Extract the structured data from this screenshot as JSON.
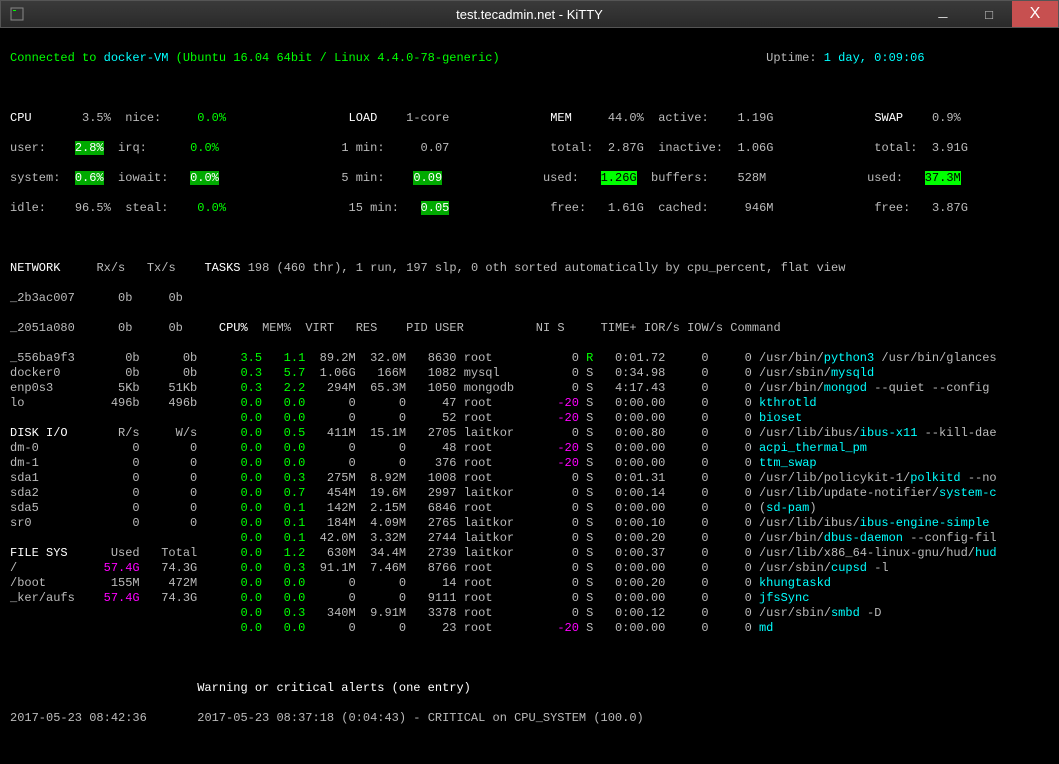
{
  "window": {
    "title": "test.tecadmin.net - KiTTY",
    "min": "_",
    "max": "□",
    "close": "X"
  },
  "header": {
    "connected": "Connected to ",
    "host": "docker-VM",
    "os": " (Ubuntu 16.04 64bit / Linux 4.4.0-78-generic)",
    "uptime_label": "Uptime: ",
    "uptime_value": "1 day, 0:09:06"
  },
  "cpu": {
    "title": "CPU",
    "pct": "3.5%",
    "user_label": "user:",
    "user_val": "2.8%",
    "system_label": "system:",
    "system_val": "0.6%",
    "idle_label": "idle:",
    "idle_val": "96.5%",
    "nice_label": "nice:",
    "nice_val": "0.0%",
    "irq_label": "irq:",
    "irq_val": "0.0%",
    "iowait_label": "iowait:",
    "iowait_val": "0.0%",
    "steal_label": "steal:",
    "steal_val": "0.0%"
  },
  "load": {
    "title": "LOAD",
    "cores": "1-core",
    "m1_label": "1 min:",
    "m1_val": "0.07",
    "m5_label": "5 min:",
    "m5_val": "0.09",
    "m15_label": "15 min:",
    "m15_val": "0.05"
  },
  "mem": {
    "title": "MEM",
    "pct": "44.0%",
    "total_label": "total:",
    "total_val": "2.87G",
    "used_label": "used:",
    "used_val": "1.26G",
    "free_label": "free:",
    "free_val": "1.61G",
    "active_label": "active:",
    "active_val": "1.19G",
    "inactive_label": "inactive:",
    "inactive_val": "1.06G",
    "buffers_label": "buffers:",
    "buffers_val": "528M",
    "cached_label": "cached:",
    "cached_val": "946M"
  },
  "swap": {
    "title": "SWAP",
    "pct": "0.9%",
    "total_label": "total:",
    "total_val": "3.91G",
    "used_label": "used:",
    "used_val": "37.3M",
    "free_label": "free:",
    "free_val": "3.87G"
  },
  "network": {
    "title": "NETWORK",
    "rx_hdr": "Rx/s",
    "tx_hdr": "Tx/s",
    "ifaces": [
      {
        "name": "_2b3ac007",
        "rx": "0b",
        "tx": "0b"
      },
      {
        "name": "_2051a080",
        "rx": "0b",
        "tx": "0b"
      },
      {
        "name": "_556ba9f3",
        "rx": "0b",
        "tx": "0b"
      },
      {
        "name": "docker0",
        "rx": "0b",
        "tx": "0b"
      },
      {
        "name": "enp0s3",
        "rx": "5Kb",
        "tx": "51Kb"
      },
      {
        "name": "lo",
        "rx": "496b",
        "tx": "496b"
      }
    ]
  },
  "disk": {
    "title": "DISK I/O",
    "r_hdr": "R/s",
    "w_hdr": "W/s",
    "items": [
      {
        "name": "dm-0",
        "r": "0",
        "w": "0"
      },
      {
        "name": "dm-1",
        "r": "0",
        "w": "0"
      },
      {
        "name": "sda1",
        "r": "0",
        "w": "0"
      },
      {
        "name": "sda2",
        "r": "0",
        "w": "0"
      },
      {
        "name": "sda5",
        "r": "0",
        "w": "0"
      },
      {
        "name": "sr0",
        "r": "0",
        "w": "0"
      }
    ]
  },
  "fs": {
    "title": "FILE SYS",
    "used_hdr": "Used",
    "total_hdr": "Total",
    "items": [
      {
        "name": "/",
        "used": "57.4G",
        "total": "74.3G",
        "hl": true
      },
      {
        "name": "/boot",
        "used": "155M",
        "total": "472M",
        "hl": false
      },
      {
        "name": "_ker/aufs",
        "used": "57.4G",
        "total": "74.3G",
        "hl": true
      }
    ]
  },
  "tasks": {
    "title": "TASKS",
    "summary": " 198 (460 thr), 1 run, 197 slp, 0 oth sorted automatically by cpu_percent, flat view",
    "hdr": {
      "cpu": "CPU%",
      "mem": "MEM%",
      "virt": "VIRT",
      "res": "RES",
      "pid": "PID",
      "user": "USER",
      "ni": "NI",
      "s": "S",
      "time": "TIME+",
      "ior": "IOR/s",
      "iow": "IOW/s",
      "cmd": "Command"
    },
    "procs": [
      {
        "cpu": "3.5",
        "mem": "1.1",
        "virt": "89.2M",
        "res": "32.0M",
        "pid": "8630",
        "user": "root",
        "ni": "0",
        "s": "R",
        "time": "0:01.72",
        "ior": "0",
        "iow": "0",
        "cmd_pre": "/usr/bin/",
        "cmd_exe": "python3",
        "cmd_post": " /usr/bin/glances"
      },
      {
        "cpu": "0.3",
        "mem": "5.7",
        "virt": "1.06G",
        "res": "166M",
        "pid": "1082",
        "user": "mysql",
        "ni": "0",
        "s": "S",
        "time": "0:34.98",
        "ior": "0",
        "iow": "0",
        "cmd_pre": "/usr/sbin/",
        "cmd_exe": "mysqld",
        "cmd_post": ""
      },
      {
        "cpu": "0.3",
        "mem": "2.2",
        "virt": "294M",
        "res": "65.3M",
        "pid": "1050",
        "user": "mongodb",
        "ni": "0",
        "s": "S",
        "time": "4:17.43",
        "ior": "0",
        "iow": "0",
        "cmd_pre": "/usr/bin/",
        "cmd_exe": "mongod",
        "cmd_post": " --quiet --config"
      },
      {
        "cpu": "0.0",
        "mem": "0.0",
        "virt": "0",
        "res": "0",
        "pid": "47",
        "user": "root",
        "ni": "-20",
        "s": "S",
        "time": "0:00.00",
        "ior": "0",
        "iow": "0",
        "cmd_pre": "",
        "cmd_exe": "kthrotld",
        "cmd_post": ""
      },
      {
        "cpu": "0.0",
        "mem": "0.0",
        "virt": "0",
        "res": "0",
        "pid": "52",
        "user": "root",
        "ni": "-20",
        "s": "S",
        "time": "0:00.00",
        "ior": "0",
        "iow": "0",
        "cmd_pre": "",
        "cmd_exe": "bioset",
        "cmd_post": ""
      },
      {
        "cpu": "0.0",
        "mem": "0.5",
        "virt": "411M",
        "res": "15.1M",
        "pid": "2705",
        "user": "laitkor",
        "ni": "0",
        "s": "S",
        "time": "0:00.80",
        "ior": "0",
        "iow": "0",
        "cmd_pre": "/usr/lib/ibus/",
        "cmd_exe": "ibus-x11",
        "cmd_post": " --kill-dae"
      },
      {
        "cpu": "0.0",
        "mem": "0.0",
        "virt": "0",
        "res": "0",
        "pid": "48",
        "user": "root",
        "ni": "-20",
        "s": "S",
        "time": "0:00.00",
        "ior": "0",
        "iow": "0",
        "cmd_pre": "",
        "cmd_exe": "acpi_thermal_pm",
        "cmd_post": ""
      },
      {
        "cpu": "0.0",
        "mem": "0.0",
        "virt": "0",
        "res": "0",
        "pid": "376",
        "user": "root",
        "ni": "-20",
        "s": "S",
        "time": "0:00.00",
        "ior": "0",
        "iow": "0",
        "cmd_pre": "",
        "cmd_exe": "ttm_swap",
        "cmd_post": ""
      },
      {
        "cpu": "0.0",
        "mem": "0.3",
        "virt": "275M",
        "res": "8.92M",
        "pid": "1008",
        "user": "root",
        "ni": "0",
        "s": "S",
        "time": "0:01.31",
        "ior": "0",
        "iow": "0",
        "cmd_pre": "/usr/lib/policykit-1/",
        "cmd_exe": "polkitd",
        "cmd_post": " --no"
      },
      {
        "cpu": "0.0",
        "mem": "0.7",
        "virt": "454M",
        "res": "19.6M",
        "pid": "2997",
        "user": "laitkor",
        "ni": "0",
        "s": "S",
        "time": "0:00.14",
        "ior": "0",
        "iow": "0",
        "cmd_pre": "/usr/lib/update-notifier/",
        "cmd_exe": "system-c",
        "cmd_post": ""
      },
      {
        "cpu": "0.0",
        "mem": "0.1",
        "virt": "142M",
        "res": "2.15M",
        "pid": "6846",
        "user": "root",
        "ni": "0",
        "s": "S",
        "time": "0:00.00",
        "ior": "0",
        "iow": "0",
        "cmd_pre": "(",
        "cmd_exe": "sd-pam",
        "cmd_post": ")"
      },
      {
        "cpu": "0.0",
        "mem": "0.1",
        "virt": "184M",
        "res": "4.09M",
        "pid": "2765",
        "user": "laitkor",
        "ni": "0",
        "s": "S",
        "time": "0:00.10",
        "ior": "0",
        "iow": "0",
        "cmd_pre": "/usr/lib/ibus/",
        "cmd_exe": "ibus-engine-simple",
        "cmd_post": ""
      },
      {
        "cpu": "0.0",
        "mem": "0.1",
        "virt": "42.0M",
        "res": "3.32M",
        "pid": "2744",
        "user": "laitkor",
        "ni": "0",
        "s": "S",
        "time": "0:00.20",
        "ior": "0",
        "iow": "0",
        "cmd_pre": "/usr/bin/",
        "cmd_exe": "dbus-daemon",
        "cmd_post": " --config-fil"
      },
      {
        "cpu": "0.0",
        "mem": "1.2",
        "virt": "630M",
        "res": "34.4M",
        "pid": "2739",
        "user": "laitkor",
        "ni": "0",
        "s": "S",
        "time": "0:00.37",
        "ior": "0",
        "iow": "0",
        "cmd_pre": "/usr/lib/x86_64-linux-gnu/hud/",
        "cmd_exe": "hud",
        "cmd_post": ""
      },
      {
        "cpu": "0.0",
        "mem": "0.3",
        "virt": "91.1M",
        "res": "7.46M",
        "pid": "8766",
        "user": "root",
        "ni": "0",
        "s": "S",
        "time": "0:00.00",
        "ior": "0",
        "iow": "0",
        "cmd_pre": "/usr/sbin/",
        "cmd_exe": "cupsd",
        "cmd_post": " -l"
      },
      {
        "cpu": "0.0",
        "mem": "0.0",
        "virt": "0",
        "res": "0",
        "pid": "14",
        "user": "root",
        "ni": "0",
        "s": "S",
        "time": "0:00.20",
        "ior": "0",
        "iow": "0",
        "cmd_pre": "",
        "cmd_exe": "khungtaskd",
        "cmd_post": ""
      },
      {
        "cpu": "0.0",
        "mem": "0.0",
        "virt": "0",
        "res": "0",
        "pid": "9111",
        "user": "root",
        "ni": "0",
        "s": "S",
        "time": "0:00.00",
        "ior": "0",
        "iow": "0",
        "cmd_pre": "",
        "cmd_exe": "jfsSync",
        "cmd_post": ""
      },
      {
        "cpu": "0.0",
        "mem": "0.3",
        "virt": "340M",
        "res": "9.91M",
        "pid": "3378",
        "user": "root",
        "ni": "0",
        "s": "S",
        "time": "0:00.12",
        "ior": "0",
        "iow": "0",
        "cmd_pre": "/usr/sbin/",
        "cmd_exe": "smbd",
        "cmd_post": " -D"
      },
      {
        "cpu": "0.0",
        "mem": "0.0",
        "virt": "0",
        "res": "0",
        "pid": "23",
        "user": "root",
        "ni": "-20",
        "s": "S",
        "time": "0:00.00",
        "ior": "0",
        "iow": "0",
        "cmd_pre": "",
        "cmd_exe": "md",
        "cmd_post": ""
      }
    ]
  },
  "footer": {
    "alerts_title": "Warning or critical alerts (one entry)",
    "now": "2017-05-23 08:42:36",
    "alert": "2017-05-23 08:37:18 (0:04:43) - CRITICAL on CPU_SYSTEM (100.0)"
  }
}
